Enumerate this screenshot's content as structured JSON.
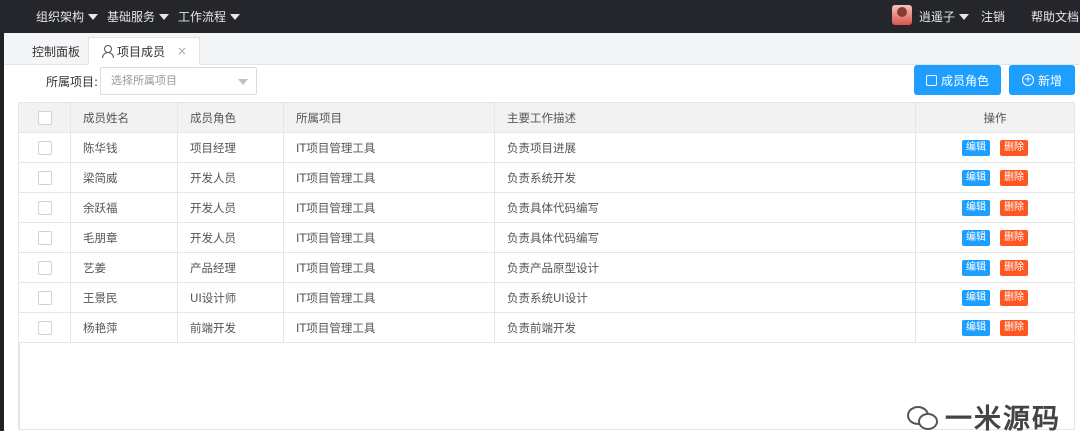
{
  "nav": {
    "menus": [
      {
        "label": "组织架构"
      },
      {
        "label": "基础服务"
      },
      {
        "label": "工作流程"
      }
    ],
    "user": "逍遥子",
    "logout": "注销",
    "help": "帮助文档"
  },
  "tabs": [
    {
      "label": "控制面板"
    },
    {
      "label": "项目成员",
      "close": "×"
    }
  ],
  "filter": {
    "label": "所属项目:",
    "placeholder": "选择所属项目"
  },
  "actions": {
    "roles": "成员角色",
    "add": "新增"
  },
  "table": {
    "headers": [
      "成员姓名",
      "成员角色",
      "所属项目",
      "主要工作描述",
      "操作"
    ],
    "rows": [
      {
        "name": "陈华钱",
        "role": "项目经理",
        "project": "IT项目管理工具",
        "desc": "负责项目进展"
      },
      {
        "name": "梁简威",
        "role": "开发人员",
        "project": "IT项目管理工具",
        "desc": "负责系统开发"
      },
      {
        "name": "余跃福",
        "role": "开发人员",
        "project": "IT项目管理工具",
        "desc": "负责具体代码编写"
      },
      {
        "name": "毛朋章",
        "role": "开发人员",
        "project": "IT项目管理工具",
        "desc": "负责具体代码编写"
      },
      {
        "name": "艺姜",
        "role": "产品经理",
        "project": "IT项目管理工具",
        "desc": "负责产品原型设计"
      },
      {
        "name": "王景民",
        "role": "UI设计师",
        "project": "IT项目管理工具",
        "desc": "负责系统UI设计"
      },
      {
        "name": "杨艳萍",
        "role": "前端开发",
        "project": "IT项目管理工具",
        "desc": "负责前端开发"
      }
    ],
    "edit_label": "编辑",
    "delete_label": "删除"
  },
  "watermark": "一米源码",
  "colors": {
    "topbar": "#24262b",
    "primary": "#1e9fff",
    "danger": "#ff5722"
  }
}
